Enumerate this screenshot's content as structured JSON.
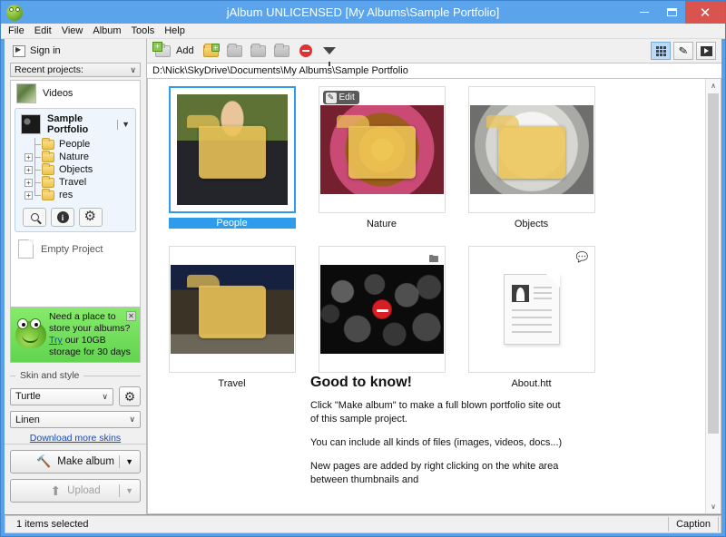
{
  "window": {
    "title": "jAlbum UNLICENSED [My Albums\\Sample Portfolio]",
    "logo_icon": "frog-logo-icon",
    "minimize_label": "–",
    "maximize_label": "□",
    "close_label": "✕"
  },
  "menubar": {
    "items": [
      "File",
      "Edit",
      "View",
      "Album",
      "Tools",
      "Help"
    ]
  },
  "sidebar": {
    "sign_in": "Sign in",
    "recent_projects_label": "Recent projects:",
    "recent_chevron": "∨",
    "projects": [
      {
        "name": "Videos"
      }
    ],
    "active_project": {
      "name": "Sample Portfolio",
      "dropdown_chevron": "▼",
      "tree": [
        {
          "label": "People",
          "expander": ""
        },
        {
          "label": "Nature",
          "expander": "+"
        },
        {
          "label": "Objects",
          "expander": "+"
        },
        {
          "label": "Travel",
          "expander": "+"
        },
        {
          "label": "res",
          "expander": "+"
        }
      ],
      "tools": [
        {
          "icon": "search-icon"
        },
        {
          "icon": "info-icon",
          "glyph": "i"
        },
        {
          "icon": "gear-icon",
          "glyph": "⚙"
        }
      ]
    },
    "empty_project": "Empty Project",
    "promo": {
      "line1": "Need a place to",
      "line2": "store your albums?",
      "link": "Try",
      "line3_rest": " our 10GB",
      "line4": "storage for 30 days",
      "close_label": "✕",
      "bg_color": "#77e15e"
    },
    "skin_section": {
      "legend": "Skin and style",
      "skin_value": "Turtle",
      "style_value": "Linen",
      "chevron": "∨",
      "settings_icon": "gear-icon",
      "download_link": "Download more skins"
    },
    "actions": {
      "make_album": "Make album",
      "make_album_icon": "hammer-icon",
      "upload": "Upload",
      "upload_icon": "upload-arrow-icon",
      "split_chevron": "▼"
    }
  },
  "toolbar": {
    "add_label": "Add",
    "icons": [
      {
        "name": "add-plus-icon"
      },
      {
        "name": "new-folder-icon"
      },
      {
        "name": "folder-up-icon"
      },
      {
        "name": "folder-back-icon"
      },
      {
        "name": "folder-forward-icon"
      },
      {
        "name": "remove-icon"
      },
      {
        "name": "filter-funnel-icon"
      }
    ],
    "view_buttons": [
      {
        "name": "grid-view-icon",
        "active": true
      },
      {
        "name": "edit-pencil-icon",
        "active": false
      },
      {
        "name": "slideshow-play-icon",
        "active": false
      }
    ]
  },
  "path": {
    "value": "D:\\Nick\\SkyDrive\\Documents\\My Albums\\Sample Portfolio"
  },
  "grid": {
    "items": [
      {
        "label": "People",
        "kind": "folder",
        "image": "ph-people",
        "selected": true,
        "badge": ""
      },
      {
        "label": "Nature",
        "kind": "folder",
        "image": "ph-nature",
        "selected": false,
        "badge": "Edit"
      },
      {
        "label": "Objects",
        "kind": "folder",
        "image": "ph-objects",
        "selected": false,
        "badge": ""
      },
      {
        "label": "Travel",
        "kind": "folder",
        "image": "ph-travel",
        "selected": false,
        "badge": ""
      },
      {
        "label": "",
        "kind": "excluded",
        "image": "ph-bokeh",
        "selected": false,
        "badge": ""
      },
      {
        "label": "About.htt",
        "kind": "document",
        "image": "",
        "selected": false,
        "badge": ""
      }
    ]
  },
  "note": {
    "heading": "Good to know!",
    "p1": "Click \"Make album\" to make a full blown portfolio site out of this sample project.",
    "p2": "You can include all kinds of files (images, videos, docs...)",
    "p3": "New pages are added by right clicking on the white area between thumbnails and"
  },
  "scrollbar": {
    "up_arrow": "∧",
    "down_arrow": "∨"
  },
  "statusbar": {
    "selection_text": "1 items selected",
    "caption_label": "Caption"
  },
  "colors": {
    "accent": "#2f9ceb",
    "titlebar": "#5ba4ec",
    "close_button": "#d9534f",
    "promo_green": "#77e15e",
    "link": "#1049c5"
  }
}
